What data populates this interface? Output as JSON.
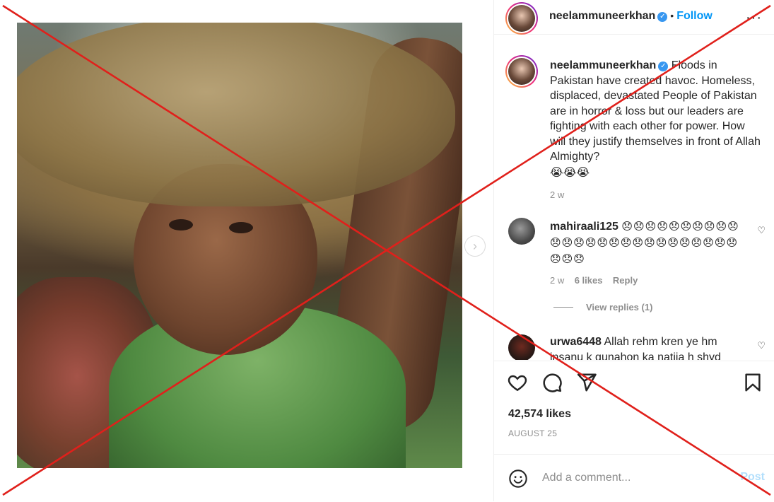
{
  "post": {
    "image_alt": "",
    "next_glyph": "›"
  },
  "header": {
    "username": "neelammuneerkhan",
    "verified_glyph": "✓",
    "separator": "•",
    "follow_label": "Follow",
    "more_glyph": "···"
  },
  "caption": {
    "username": "neelammuneerkhan",
    "text": "Floods in Pakistan have created havoc. Homeless, displaced, devastated People of Pakistan are in horror & loss but our leaders are fighting with each other for power. How will they justify themselves in front of Allah Almighty?",
    "emojis": "😭😭😭",
    "time": "2 w"
  },
  "comments": [
    {
      "username": "mahiraali125",
      "text": "😞😞😞😞😞😞😞😞😞😞😞😞😞😞😞😞😞😞😞😞😞😞😞😞😞😞😞😞😞",
      "time": "2 w",
      "likes": "6 likes",
      "reply": "Reply"
    },
    {
      "username": "urwa6448",
      "text": "Allah rehm kren ye hm insanu k gunahon ka natija h shyd",
      "time": "",
      "likes": "",
      "reply": ""
    }
  ],
  "view_replies": "View replies (1)",
  "likes_count": "42,574 likes",
  "post_date": "AUGUST 25",
  "comment_bar": {
    "placeholder": "Add a comment...",
    "post_label": "Post"
  },
  "colors": {
    "accent": "#0095f6",
    "cross": "#e0201b"
  }
}
